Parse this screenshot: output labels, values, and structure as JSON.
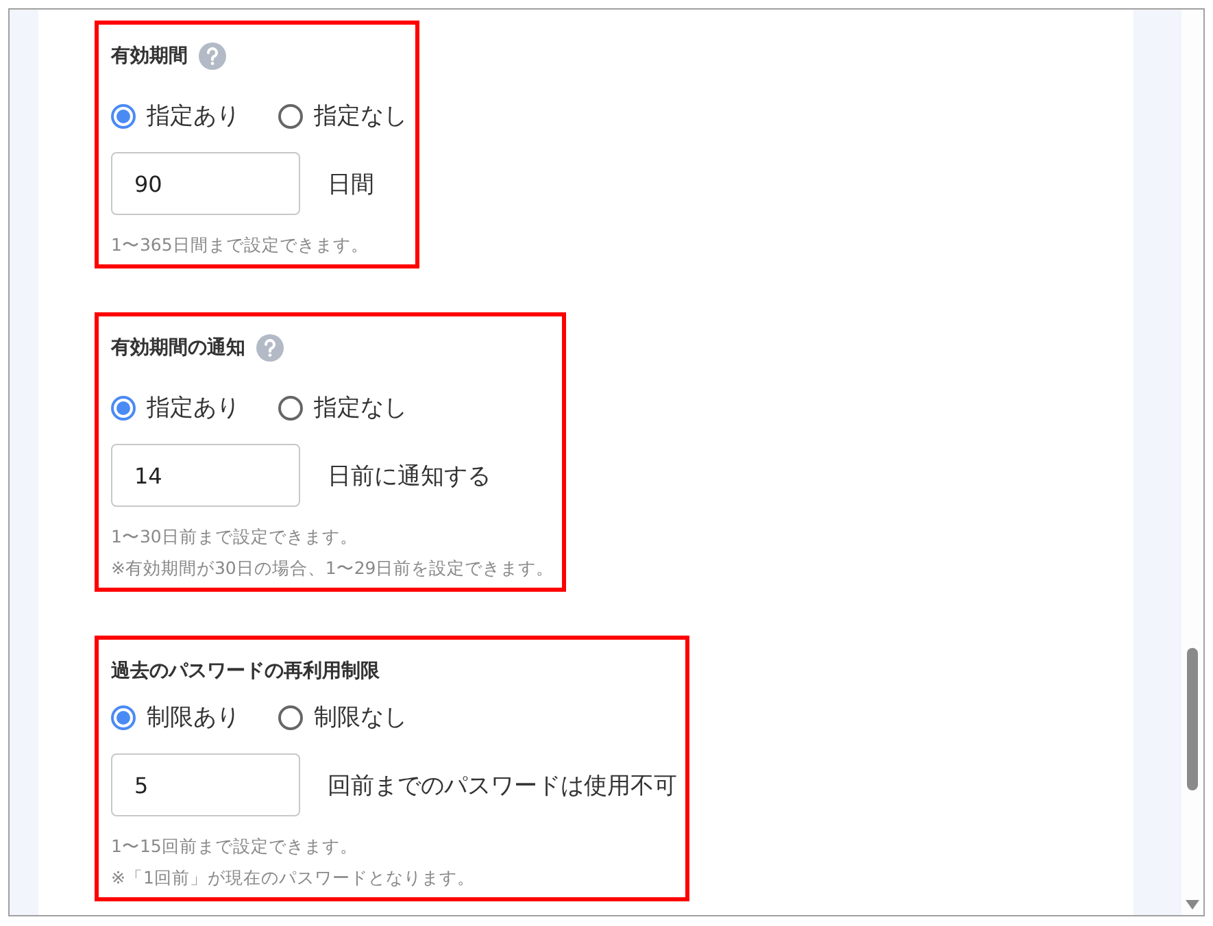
{
  "sections": [
    {
      "title": "有効期間",
      "help": true,
      "options": [
        {
          "label": "指定あり",
          "selected": true
        },
        {
          "label": "指定なし",
          "selected": false
        }
      ],
      "value": "90",
      "unit": "日間",
      "notes": [
        "1〜365日間まで設定できます。"
      ]
    },
    {
      "title": "有効期間の通知",
      "help": true,
      "options": [
        {
          "label": "指定あり",
          "selected": true
        },
        {
          "label": "指定なし",
          "selected": false
        }
      ],
      "value": "14",
      "unit": "日前に通知する",
      "notes": [
        "1〜30日前まで設定できます。",
        "※有効期間が30日の場合、1〜29日前を設定できます。"
      ]
    },
    {
      "title": "過去のパスワードの再利用制限",
      "help": false,
      "options": [
        {
          "label": "制限あり",
          "selected": true
        },
        {
          "label": "制限なし",
          "selected": false
        }
      ],
      "value": "5",
      "unit": "回前までのパスワードは使用不可",
      "notes": [
        "1〜15回前まで設定できます。",
        "※「1回前」が現在のパスワードとなります。"
      ]
    }
  ]
}
